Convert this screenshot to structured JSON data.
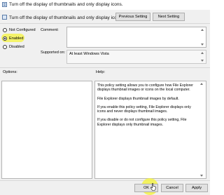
{
  "window": {
    "title": "Turn off the display of thumbnails and only display icons.",
    "header": "Turn off the display of thumbnails and only display icons."
  },
  "nav": {
    "previous_label": "Previous Setting",
    "next_label": "Next Setting"
  },
  "state": {
    "options": [
      {
        "label": "Not Configured",
        "checked": false
      },
      {
        "label": "Enabled",
        "checked": true
      },
      {
        "label": "Disabled",
        "checked": false
      }
    ],
    "highlight_color": "#f4f36a"
  },
  "fields": {
    "comment_label": "Comment:",
    "comment_value": "",
    "supported_label": "Supported on:",
    "supported_value": "At least Windows Vista"
  },
  "panes": {
    "options_label": "Options:",
    "help_label": "Help:",
    "help_paragraphs": [
      "This policy setting allows you to configure how File Explorer displays thumbnail images or icons on the local computer.",
      "File Explorer displays thumbnail images by default.",
      "If you enable this policy setting, File Explorer displays only icons and never displays thumbnail images.",
      "If you disable or do not configure this policy setting, File Explorer displays only thumbnail images."
    ]
  },
  "footer": {
    "ok_label": "OK",
    "cancel_label": "Cancel",
    "apply_label": "Apply"
  }
}
